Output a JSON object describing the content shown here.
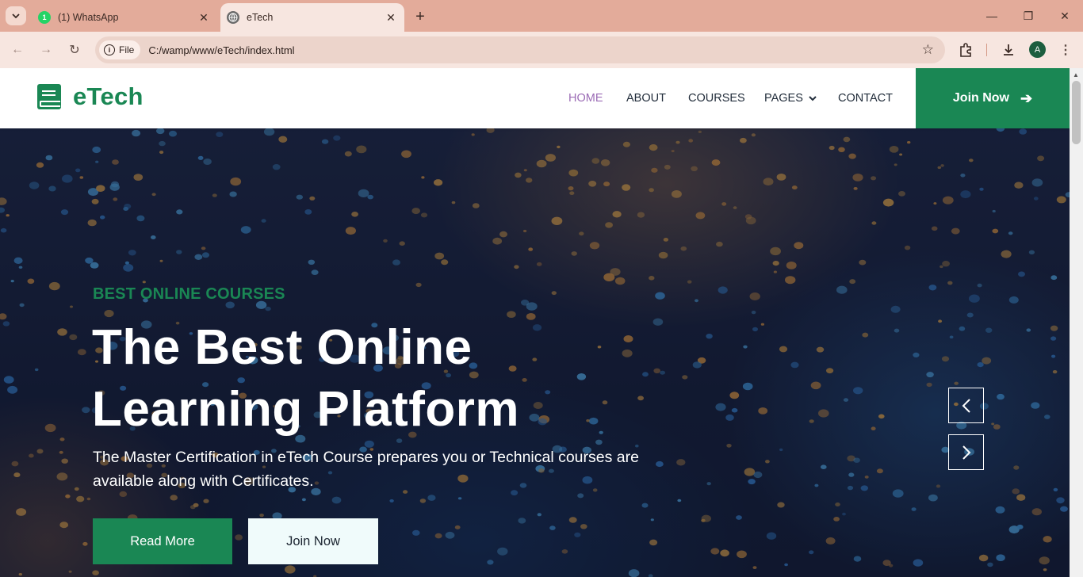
{
  "browser": {
    "tabs": [
      {
        "title": "(1) WhatsApp",
        "badge": "1",
        "active": false
      },
      {
        "title": "eTech",
        "active": true
      }
    ],
    "address_chip": "File",
    "url": "C:/wamp/www/eTech/index.html",
    "profile_initial": "A"
  },
  "site": {
    "brand": "eTech",
    "nav": {
      "home": "HOME",
      "about": "ABOUT",
      "courses": "COURSES",
      "pages": "PAGES",
      "contact": "CONTACT"
    },
    "join_button": "Join Now"
  },
  "hero": {
    "eyebrow": "BEST ONLINE COURSES",
    "heading_line1": "The Best Online",
    "heading_line2": "Learning Platform",
    "lead": "The Master Certification in eTech Course prepares you or Technical courses are available along with Certificates.",
    "read_more": "Read More",
    "join_now": "Join Now"
  },
  "colors": {
    "accent": "#1a8754",
    "nav_active": "#9b6bb5",
    "browser_tabbar": "#e3ab9a"
  }
}
